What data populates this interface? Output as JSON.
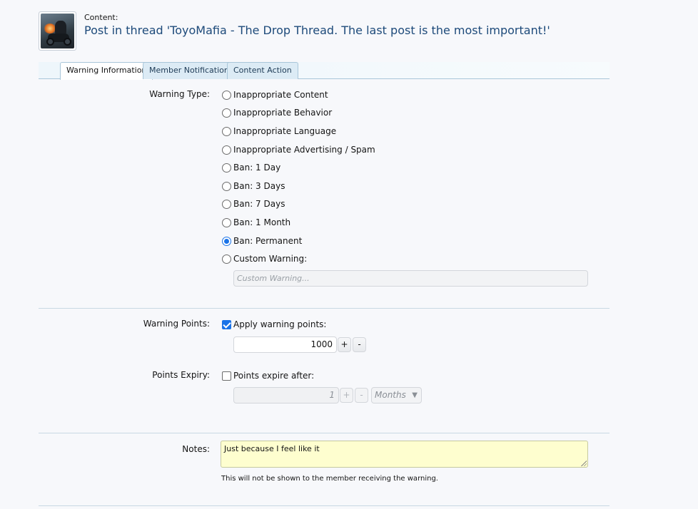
{
  "header": {
    "content_label": "Content:",
    "content_title": "Post in thread 'ToyoMafia - The Drop Thread. The last post is the most important!'"
  },
  "tabs": [
    {
      "label": "Warning Information",
      "active": true
    },
    {
      "label": "Member Notification",
      "active": false
    },
    {
      "label": "Content Action",
      "active": false
    }
  ],
  "warning_type": {
    "label": "Warning Type:",
    "options": [
      {
        "label": "Inappropriate Content",
        "checked": false
      },
      {
        "label": "Inappropriate Behavior",
        "checked": false
      },
      {
        "label": "Inappropriate Language",
        "checked": false
      },
      {
        "label": "Inappropriate Advertising / Spam",
        "checked": false
      },
      {
        "label": "Ban: 1 Day",
        "checked": false
      },
      {
        "label": "Ban: 3 Days",
        "checked": false
      },
      {
        "label": "Ban: 7 Days",
        "checked": false
      },
      {
        "label": "Ban: 1 Month",
        "checked": false
      },
      {
        "label": "Ban: Permanent",
        "checked": true
      },
      {
        "label": "Custom Warning:",
        "checked": false
      }
    ],
    "custom_placeholder": "Custom Warning..."
  },
  "warning_points": {
    "label": "Warning Points:",
    "checkbox_label": "Apply warning points:",
    "checked": true,
    "value": "1000",
    "plus": "+",
    "minus": "-"
  },
  "points_expiry": {
    "label": "Points Expiry:",
    "checkbox_label": "Points expire after:",
    "checked": false,
    "value": "1",
    "plus": "+",
    "minus": "-",
    "unit": "Months"
  },
  "notes": {
    "label": "Notes:",
    "value": "Just because I feel like it",
    "hint": "This will not be shown to the member receiving the warning."
  }
}
